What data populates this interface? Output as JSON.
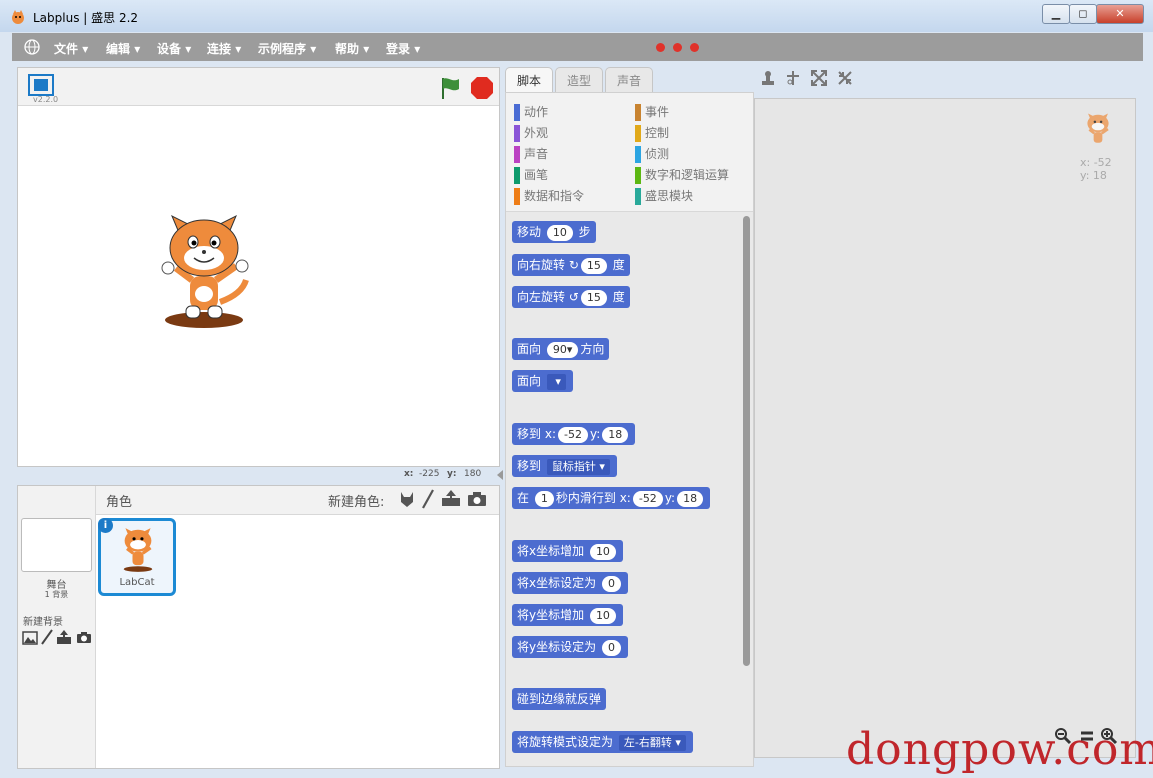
{
  "window": {
    "title": "Labplus | 盛思 2.2",
    "minimize_icon": "minimize-icon",
    "maximize_icon": "maximize-icon",
    "close_icon": "close-icon"
  },
  "menu": {
    "items": [
      "文件",
      "编辑",
      "设备",
      "连接",
      "示例程序",
      "帮助",
      "登录"
    ],
    "dot_color": "#e0322a"
  },
  "stage": {
    "version": "v2.2.0",
    "coords": {
      "x_label": "x:",
      "x_value": "-225",
      "y_label": "y:",
      "y_value": "180"
    }
  },
  "sprites": {
    "header": "角色",
    "new_sprite": "新建角色:",
    "stage_label": "舞台",
    "backdrops": "1 背景",
    "new_backdrop": "新建背景",
    "sprite_name": "LabCat"
  },
  "tabs": [
    "脚本",
    "造型",
    "声音"
  ],
  "categories": {
    "left": [
      {
        "label": "动作",
        "color": "#4a6cd4"
      },
      {
        "label": "外观",
        "color": "#8a55d7"
      },
      {
        "label": "声音",
        "color": "#bb42c3"
      },
      {
        "label": "画笔",
        "color": "#0e9a6c"
      },
      {
        "label": "数据和指令",
        "color": "#ee7d16"
      }
    ],
    "right": [
      {
        "label": "事件",
        "color": "#c88330"
      },
      {
        "label": "控制",
        "color": "#e1a91a"
      },
      {
        "label": "侦测",
        "color": "#2ca5e2"
      },
      {
        "label": "数字和逻辑运算",
        "color": "#5cb712"
      },
      {
        "label": "盛思模块",
        "color": "#29a99a"
      }
    ]
  },
  "blocks": {
    "move": {
      "a": "移动",
      "v": "10",
      "b": "步"
    },
    "turn_right": {
      "a": "向右旋转",
      "v": "15",
      "b": "度"
    },
    "turn_left": {
      "a": "向左旋转",
      "v": "15",
      "b": "度"
    },
    "point_dir": {
      "a": "面向",
      "v": "90",
      "b": "方向"
    },
    "point_to": {
      "a": "面向"
    },
    "goto_xy": {
      "a": "移到",
      "xl": "x:",
      "x": "-52",
      "yl": "y:",
      "y": "18"
    },
    "goto": {
      "a": "移到",
      "v": "鼠标指针"
    },
    "glide": {
      "a": "在",
      "v": "1",
      "b": "秒内滑行到",
      "xl": "x:",
      "x": "-52",
      "yl": "y:",
      "y": "18"
    },
    "change_x": {
      "a": "将x坐标增加",
      "v": "10"
    },
    "set_x": {
      "a": "将x坐标设定为",
      "v": "0"
    },
    "change_y": {
      "a": "将y坐标增加",
      "v": "10"
    },
    "set_y": {
      "a": "将y坐标设定为",
      "v": "0"
    },
    "bounce": {
      "a": "碰到边缘就反弹"
    },
    "rotation": {
      "a": "将旋转模式设定为",
      "v": "左-右翻转"
    }
  },
  "script_area": {
    "sprite_x": "x: -52",
    "sprite_y": "y: 18"
  },
  "watermark": "dongpow.com"
}
